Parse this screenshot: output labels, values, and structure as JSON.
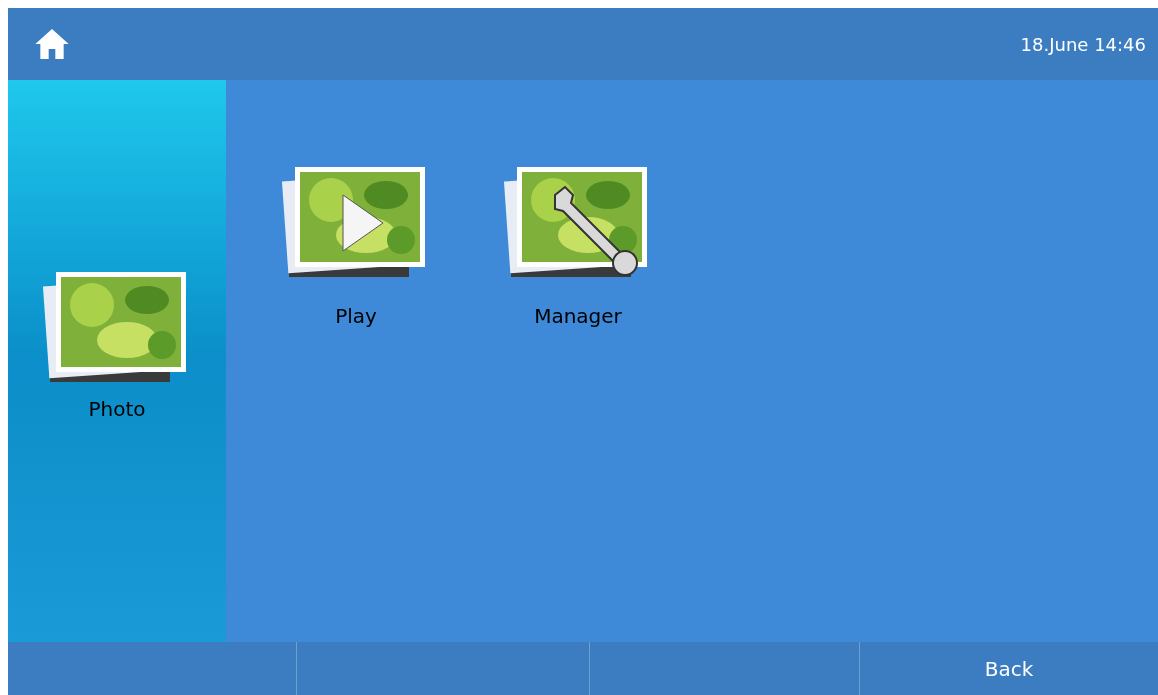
{
  "header": {
    "datetime": "18.June 14:46"
  },
  "sidebar": {
    "label": "Photo"
  },
  "apps": [
    {
      "label": "Play",
      "kind": "play"
    },
    {
      "label": "Manager",
      "kind": "tool"
    }
  ],
  "footer": {
    "back_label": "Back"
  }
}
